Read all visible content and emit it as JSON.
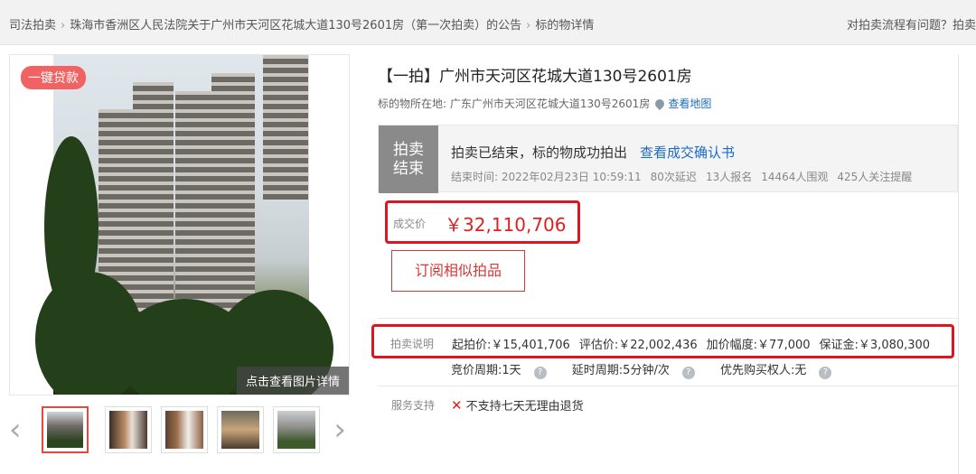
{
  "breadcrumb": {
    "items": [
      "司法拍卖",
      "珠海市香洲区人民法院关于广州市天河区花城大道130号2601房（第一次拍卖）的公告",
      "标的物详情"
    ],
    "sep": "›"
  },
  "help_text": "对拍卖流程有问题？拍卖",
  "gallery": {
    "loan_badge": "一键贷款",
    "view_detail": "点击查看图片详情",
    "prev_icon": "chevron-left-icon",
    "next_icon": "chevron-right-icon"
  },
  "item": {
    "title": "【一拍】广州市天河区花城大道130号2601房",
    "location_label": "标的物所在地:",
    "location_value": "广东广州市天河区花城大道130号2601房",
    "map_link": "查看地图"
  },
  "status": {
    "tag_line1": "拍卖",
    "tag_line2": "结束",
    "main": "拍卖已结束，标的物成功拍出",
    "confirm_link": "查看成交确认书",
    "end_time": "结束时间:  2022年02月23日 10:59:11",
    "delays": "80次延迟",
    "signups": "13人报名",
    "viewers": "14464人围观",
    "reminders": "425人关注提醒"
  },
  "deal": {
    "label": "成交价",
    "price": "￥32,110,706"
  },
  "subscribe_label": "订阅相似拍品",
  "rules": {
    "label": "拍卖说明",
    "start_price": "起拍价:￥15,401,706",
    "appraisal": "评估价:￥22,002,436",
    "increment": "加价幅度:￥77,000",
    "deposit": "保证金:￥3,080,300",
    "bid_period": "竞价周期:1天",
    "delay_period": "延时周期:5分钟/次",
    "priority": "优先购买权人:无",
    "qmark": "?"
  },
  "service": {
    "label": "服务支持",
    "value": "不支持七天无理由退货",
    "x": "✕"
  },
  "colors": {
    "accent_red": "#e0161e",
    "link_blue": "#1b6bc4"
  }
}
